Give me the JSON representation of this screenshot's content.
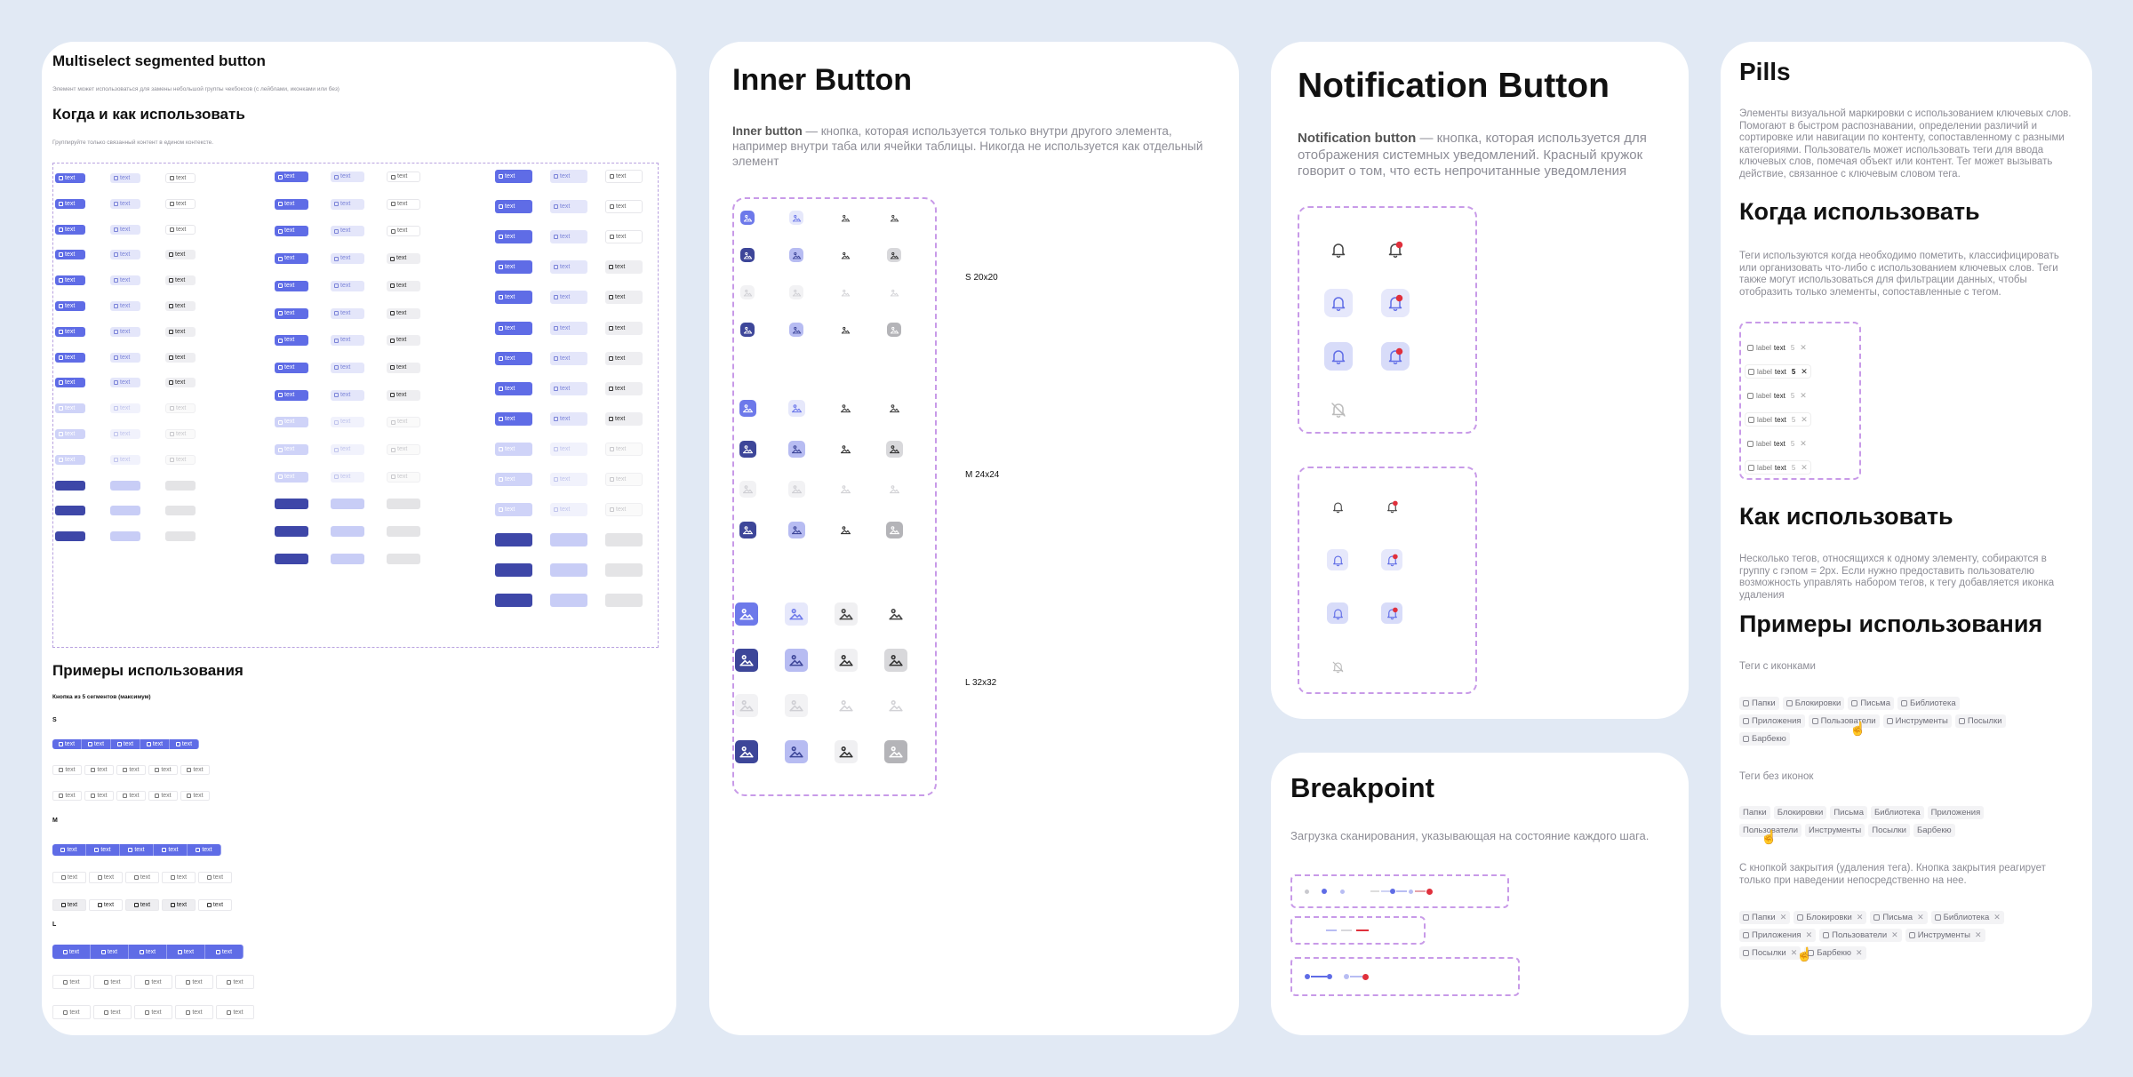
{
  "multiselect": {
    "title": "Multiselect segmented button",
    "subtitle": "Элемент может использоваться для замены небольшой группы чекбоксов (с лейблами, иконками или без)",
    "when_title": "Когда и как использовать",
    "when_text": "Группируйте только связанный контент в едином контексте.",
    "chip_label": "text",
    "examples_title": "Примеры использования",
    "examples_sub": "Кнопка из 5 сегментов (максимум)",
    "size_s": "S",
    "size_m": "M",
    "size_l": "L"
  },
  "inner_button": {
    "title": "Inner Button",
    "desc_bold": "Inner button",
    "desc": " — кнопка, которая используется только внутри другого элемента, например внутри таба или ячейки таблицы. Никогда не используется как отдельный элемент",
    "size_s": "S 20x20",
    "size_m": "M 24x24",
    "size_l": "L 32x32"
  },
  "notification": {
    "title": "Notification Button",
    "desc_bold": "Notification button",
    "desc": " — кнопка, которая используется для отображения системных уведомлений. Красный кружок говорит о том, что есть непрочитанные уведомления"
  },
  "breakpoint": {
    "title": "Breakpoint",
    "desc": "Загрузка сканирования, указывающая на состояние каждого шага."
  },
  "pills": {
    "title": "Pills",
    "intro": "Элементы визуальной маркировки с использованием ключевых слов. Помогают в быстром распознавании, определении различий и сортировке или навигации по контенту, сопоставленному с разными категориями. Пользователь может использовать теги для ввода ключевых слов, помечая объект или контент. Тег может вызывать действие, связанное с ключевым словом тега.",
    "when_title": "Когда использовать",
    "when_text": "Теги используются когда необходимо пометить, классифицировать или организовать что-либо с использованием ключевых слов. Теги также могут использоваться для фильтрации данных, чтобы отобразить только элементы, сопоставленные с тегом.",
    "pill_label": "label",
    "pill_text": "text",
    "pill_count": "5",
    "howto_title": "Как использовать",
    "howto_text": "Несколько тегов, относящихся к одному элементу, собираются в группу с гэпом = 2px. Если нужно предоставить пользователю возможность управлять набором тегов, к тегу добавляется иконка удаления",
    "examples_title": "Примеры использования",
    "with_icons": "Теги с иконками",
    "without_icons": "Теги без иконок",
    "with_close": "С кнопкой закрытия (удаления тега). Кнопка закрытия реагирует только при наведении непосредственно на нее.",
    "tags_icons_row1": [
      "Папки",
      "Блокировки",
      "Письма",
      "Библиотека"
    ],
    "tags_icons_row2": [
      "Приложения",
      "Пользователи",
      "Инструменты",
      "Посылки"
    ],
    "tags_icons_row3": [
      "Барбекю"
    ],
    "tags_plain_row1": [
      "Папки",
      "Блокировки",
      "Письма",
      "Библиотека",
      "Приложения"
    ],
    "tags_plain_row2": [
      "Пользователи",
      "Инструменты",
      "Посылки",
      "Барбекю"
    ],
    "tags_close_row1": [
      "Папки",
      "Блокировки",
      "Письма",
      "Библиотека"
    ],
    "tags_close_row2": [
      "Приложения",
      "Пользователи",
      "Инструменты"
    ],
    "tags_close_row3": [
      "Посылки",
      "Барбекю"
    ]
  },
  "colors": {
    "accent": "#5f6ce6",
    "accent_dark": "#3e47a8",
    "dashed": "#c89ae8",
    "alert": "#e0303c",
    "background": "#e1e9f4"
  }
}
